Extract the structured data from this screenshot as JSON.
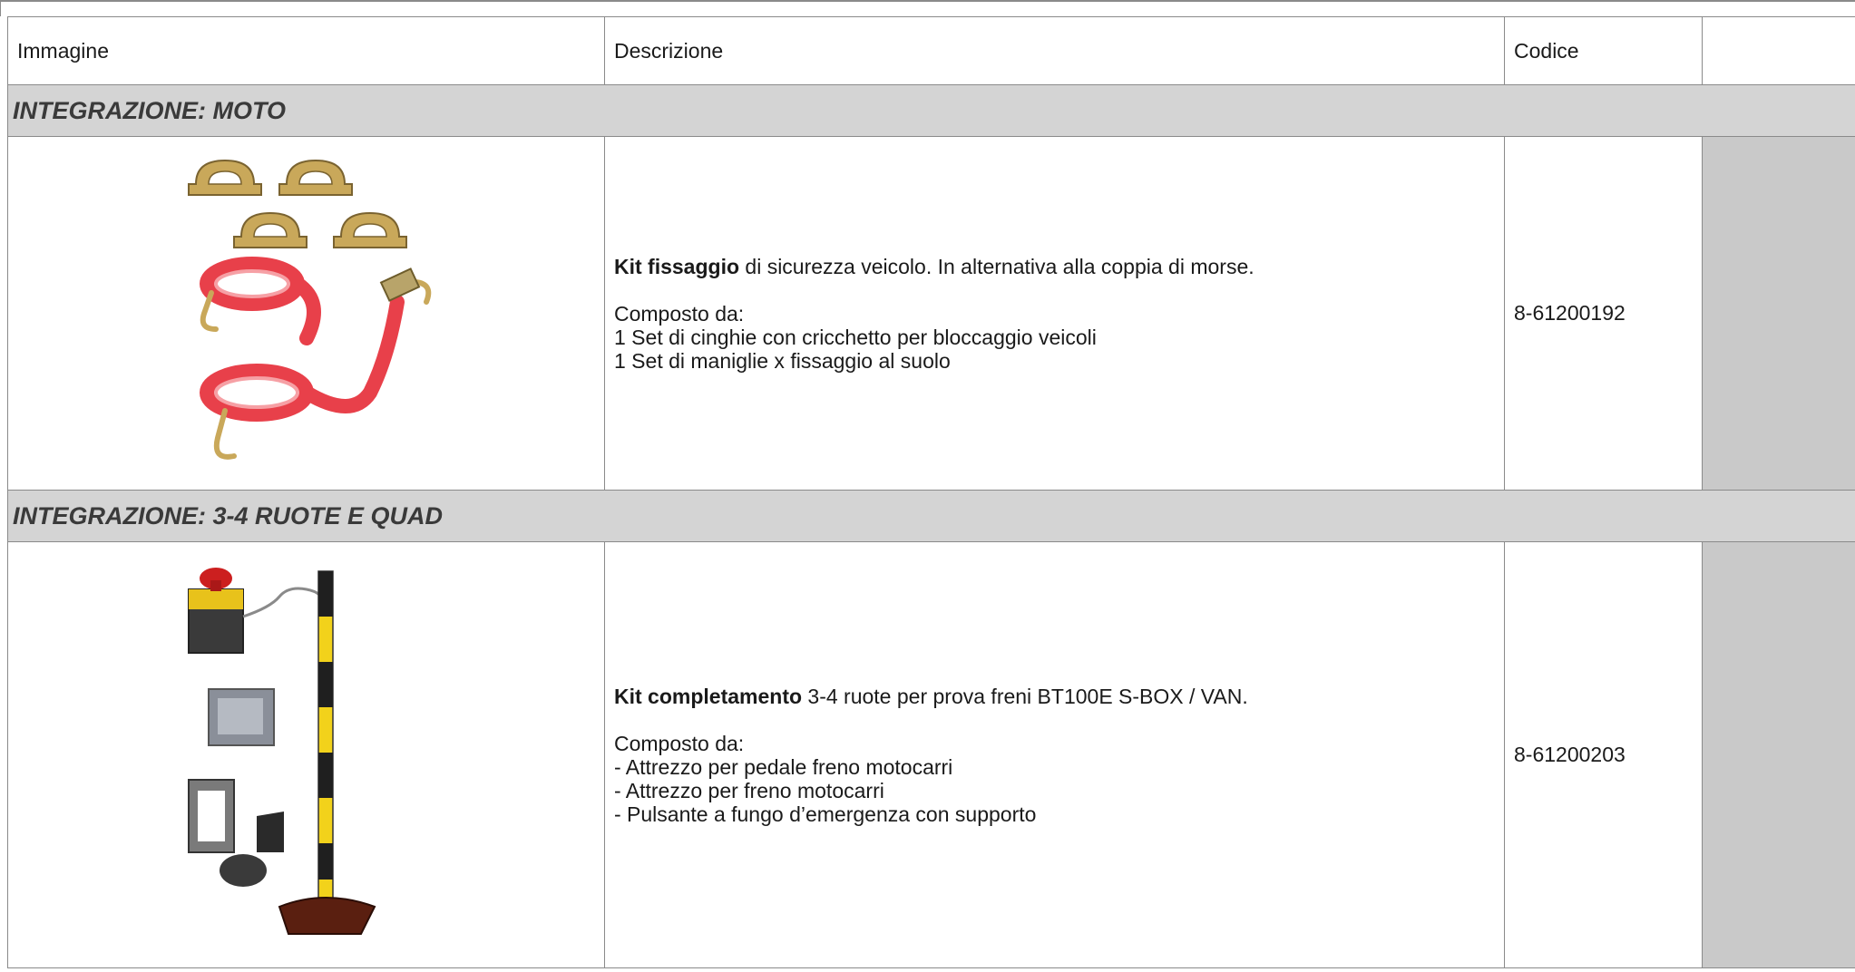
{
  "table": {
    "headers": {
      "image": "Immagine",
      "description": "Descrizione",
      "code": "Codice",
      "extra": ""
    },
    "sections": [
      {
        "title": "INTEGRAZIONE: MOTO",
        "product": {
          "name_bold": "Kit fissaggio",
          "name_rest": " di sicurezza veicolo. In alternativa alla coppia di morse.",
          "composed_label": "Composto da:",
          "items": [
            "1 Set di cinghie con cricchetto per bloccaggio veicoli",
            "1 Set di maniglie x fissaggio al suolo"
          ],
          "code": "8-61200192"
        }
      },
      {
        "title": "INTEGRAZIONE: 3-4 RUOTE E QUAD",
        "product": {
          "name_bold": "Kit completamento",
          "name_rest": " 3-4 ruote per prova freni BT100E S-BOX / VAN.",
          "composed_label": "Composto da:",
          "items": [
            "- Attrezzo per pedale freno motocarri",
            "- Attrezzo per freno motocarri",
            "- Pulsante a fungo d’emergenza con supporto"
          ],
          "code": "8-61200203"
        }
      }
    ]
  },
  "colors": {
    "section_bg": "#d4d4d4",
    "gray_column": "#c9c9c9",
    "strap_red": "#e8404a",
    "pole_yellow": "#f2d21b"
  }
}
